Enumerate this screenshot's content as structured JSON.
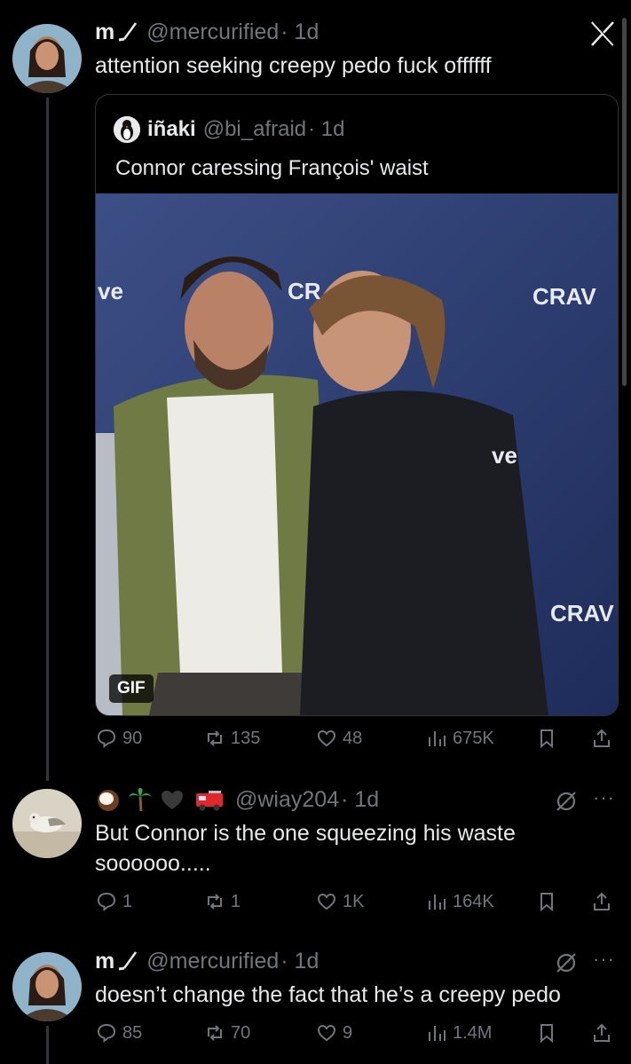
{
  "tweet1": {
    "name": "m",
    "name_emoji": "hockey-stick",
    "handle": "@mercurified",
    "time": "· 1d",
    "text": "attention seeking creepy pedo fuck offffff",
    "quote": {
      "name": "iñaki",
      "handle": "@bi_afraid",
      "time": "· 1d",
      "text": "Connor caressing François' waist",
      "media_badge": "GIF",
      "media_signage": [
        "ve",
        "CR",
        "CRAV",
        "ve",
        "CRAV"
      ]
    },
    "stats": {
      "replies": "90",
      "reposts": "135",
      "likes": "48",
      "views": "675K"
    }
  },
  "tweet2": {
    "name_emojis": [
      "coconut",
      "palm-tree",
      "black-heart",
      "fire-engine"
    ],
    "handle": "@wiay204",
    "time": "· 1d",
    "text": "But Connor is the one squeezing his waste soooooo.....",
    "stats": {
      "replies": "1",
      "reposts": "1",
      "likes": "1K",
      "views": "164K"
    }
  },
  "tweet3": {
    "name": "m",
    "name_emoji": "hockey-stick",
    "handle": "@mercurified",
    "time": "· 1d",
    "text": "doesn’t change the fact that he’s a creepy pedo",
    "stats": {
      "replies": "85",
      "reposts": "70",
      "likes": "9",
      "views": "1.4M"
    }
  },
  "colors": {
    "background": "#000000",
    "text": "#e7e9ea",
    "muted": "#71767b",
    "border": "#2f3336"
  }
}
